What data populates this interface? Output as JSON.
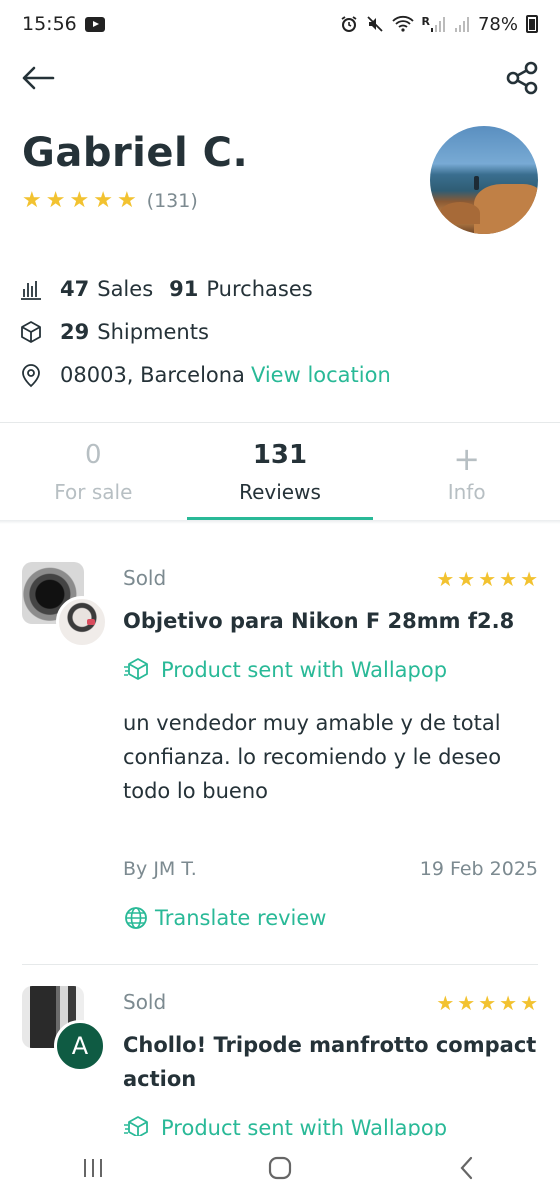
{
  "status": {
    "time": "15:56",
    "battery": "78%",
    "net_label": "R"
  },
  "profile": {
    "name": "Gabriel C.",
    "rating_stars": 5,
    "review_count": "(131)",
    "sales_count": "47",
    "sales_label": "Sales",
    "purchases_count": "91",
    "purchases_label": "Purchases",
    "shipments_count": "29",
    "shipments_label": "Shipments",
    "location": "08003, Barcelona",
    "view_location": "View location"
  },
  "tabs": [
    {
      "count": "0",
      "label": "For sale"
    },
    {
      "count": "131",
      "label": "Reviews"
    },
    {
      "count": "+",
      "label": "Info"
    }
  ],
  "reviews": [
    {
      "status": "Sold",
      "stars": 5,
      "title": "Objetivo para Nikon F   28mm f2.8",
      "sent_label": "Product sent with Wallapop",
      "comment": "un vendedor muy amable y de total confianza. lo recomiendo y le deseo todo lo bueno",
      "by": "By JM T.",
      "date": "19 Feb 2025",
      "translate": "Translate review"
    },
    {
      "status": "Sold",
      "stars": 5,
      "title": "Chollo! Tripode manfrotto compact action",
      "sent_label": "Product sent with Wallapop",
      "avatar_letter": "A"
    }
  ],
  "colors": {
    "accent": "#29b997",
    "star": "#f2c230",
    "text": "#253238",
    "muted": "#7c8a90",
    "avatar_a": "#0f5b43"
  }
}
